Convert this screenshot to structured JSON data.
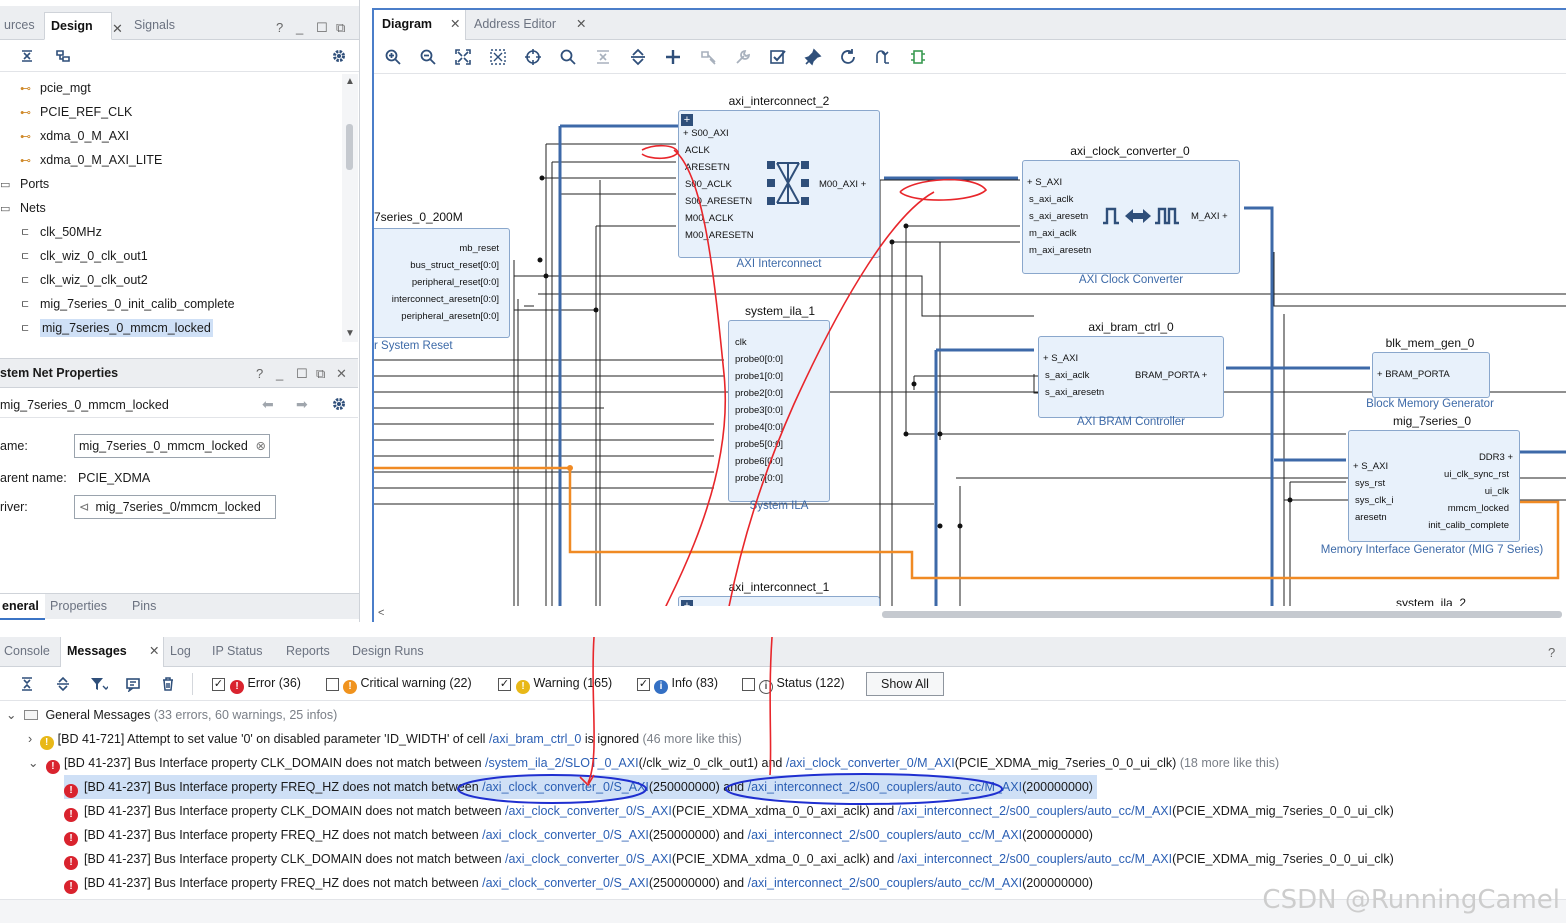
{
  "left": {
    "tabs": [
      "urces",
      "Design",
      "Signals"
    ],
    "tree": [
      {
        "label": "pcie_mgt",
        "kind": "port"
      },
      {
        "label": "PCIE_REF_CLK",
        "kind": "port"
      },
      {
        "label": "xdma_0_M_AXI",
        "kind": "port"
      },
      {
        "label": "xdma_0_M_AXI_LITE",
        "kind": "port"
      },
      {
        "label": "Ports",
        "kind": "folder"
      },
      {
        "label": "Nets",
        "kind": "folder"
      },
      {
        "label": "clk_50MHz",
        "kind": "net"
      },
      {
        "label": "clk_wiz_0_clk_out1",
        "kind": "net"
      },
      {
        "label": "clk_wiz_0_clk_out2",
        "kind": "net"
      },
      {
        "label": "mig_7series_0_init_calib_complete",
        "kind": "net"
      },
      {
        "label": "mig_7series_0_mmcm_locked",
        "kind": "net"
      }
    ],
    "props_title": "stem Net Properties",
    "props_net": "mig_7series_0_mmcm_locked",
    "name_label": "ame:",
    "name_value": "mig_7series_0_mmcm_locked",
    "parent_label": "arent name:",
    "parent_value": "PCIE_XDMA",
    "driver_label": "river:",
    "driver_value": "mig_7series_0/mmcm_locked",
    "bottom_tabs": [
      "eneral",
      "Properties",
      "Pins"
    ]
  },
  "diagram": {
    "tabs": [
      "Diagram",
      "Address Editor"
    ],
    "blocks": {
      "ic2": {
        "title": "axi_interconnect_2",
        "sub": "AXI Interconnect",
        "pins": [
          "S00_AXI",
          "ACLK",
          "ARESETN",
          "S00_ACLK",
          "S00_ARESETN",
          "M00_ACLK",
          "M00_ARESETN"
        ],
        "out": "M00_AXI"
      },
      "cc": {
        "title": "axi_clock_converter_0",
        "sub": "AXI Clock Converter",
        "pins": [
          "S_AXI",
          "s_axi_aclk",
          "s_axi_aresetn",
          "m_axi_aclk",
          "m_axi_aresetn"
        ],
        "out": "M_AXI"
      },
      "rst": {
        "title": "7series_0_200M",
        "sub": "r System Reset",
        "pins": [
          "mb_reset",
          "bus_struct_reset[0:0]",
          "peripheral_reset[0:0]",
          "interconnect_aresetn[0:0]",
          "peripheral_aresetn[0:0]"
        ]
      },
      "ila": {
        "title": "system_ila_1",
        "sub": "System ILA",
        "pins": [
          "clk",
          "probe0[0:0]",
          "probe1[0:0]",
          "probe2[0:0]",
          "probe3[0:0]",
          "probe4[0:0]",
          "probe5[0:0]",
          "probe6[0:0]",
          "probe7[0:0]"
        ]
      },
      "bram": {
        "title": "axi_bram_ctrl_0",
        "sub": "AXI BRAM Controller",
        "pins": [
          "S_AXI",
          "s_axi_aclk",
          "s_axi_aresetn"
        ],
        "out": "BRAM_PORTA"
      },
      "bmg": {
        "title": "blk_mem_gen_0",
        "sub": "Block Memory Generator",
        "pins": [
          "BRAM_PORTA"
        ]
      },
      "mig": {
        "title": "mig_7series_0",
        "sub": "Memory Interface Generator (MIG 7 Series)",
        "pins": [
          "S_AXI",
          "sys_rst",
          "sys_clk_i",
          "aresetn"
        ],
        "outs": [
          "DDR3",
          "ui_clk_sync_rst",
          "ui_clk",
          "mmcm_locked",
          "init_calib_complete"
        ]
      },
      "ic1": {
        "title": "axi_interconnect_1"
      },
      "ila2": {
        "title": "system_ila_2"
      }
    }
  },
  "messages": {
    "tabs": [
      "Console",
      "Messages",
      "Log",
      "IP Status",
      "Reports",
      "Design Runs"
    ],
    "filters": [
      {
        "label": "Error (36)",
        "checked": true,
        "color": "#d9232e",
        "glyph": "!"
      },
      {
        "label": "Critical warning (22)",
        "checked": false,
        "color": "#f0931e",
        "glyph": "!"
      },
      {
        "label": "Warning (165)",
        "checked": true,
        "color": "#e8b818",
        "glyph": "!"
      },
      {
        "label": "Info (83)",
        "checked": true,
        "color": "#3470c4",
        "glyph": "i"
      },
      {
        "label": "Status (122)",
        "checked": false,
        "color": "#ffffff",
        "glyph": "i"
      }
    ],
    "show_all": "Show All",
    "group": {
      "title": "General Messages",
      "counts": "(33 errors, 60 warnings, 25 infos)"
    },
    "rows": [
      {
        "type": "warning",
        "text1": "[BD 41-721] Attempt to set value '0' on disabled parameter 'ID_WIDTH' of cell ",
        "link1": "/axi_bram_ctrl_0",
        "text2": " is ignored ",
        "gray": "(46 more like this)"
      },
      {
        "type": "error",
        "text1": "[BD 41-237] Bus Interface property CLK_DOMAIN does not match between ",
        "link1": "/system_ila_2/SLOT_0_AXI",
        "text2": "(/clk_wiz_0_clk_out1) and ",
        "link2": "/axi_clock_converter_0/M_AXI",
        "text3": "(PCIE_XDMA_mig_7series_0_0_ui_clk) ",
        "gray": "(18 more like this)"
      },
      {
        "type": "error",
        "text1": "[BD 41-237] Bus Interface property FREQ_HZ does not match between ",
        "link1": "/axi_clock_converter_0/S_AXI",
        "text2": "(250000000) and ",
        "link2": "/axi_interconnect_2/s00_couplers/auto_cc/M_AXI",
        "text3": "(200000000)"
      },
      {
        "type": "error",
        "text1": "[BD 41-237] Bus Interface property CLK_DOMAIN does not match between ",
        "link1": "/axi_clock_converter_0/S_AXI",
        "text2": "(PCIE_XDMA_xdma_0_0_axi_aclk) and ",
        "link2": "/axi_interconnect_2/s00_couplers/auto_cc/M_AXI",
        "text3": "(PCIE_XDMA_mig_7series_0_0_ui_clk)"
      },
      {
        "type": "error",
        "text1": "[BD 41-237] Bus Interface property FREQ_HZ does not match between ",
        "link1": "/axi_clock_converter_0/S_AXI",
        "text2": "(250000000) and ",
        "link2": "/axi_interconnect_2/s00_couplers/auto_cc/M_AXI",
        "text3": "(200000000)"
      },
      {
        "type": "error",
        "text1": "[BD 41-237] Bus Interface property CLK_DOMAIN does not match between ",
        "link1": "/axi_clock_converter_0/S_AXI",
        "text2": "(PCIE_XDMA_xdma_0_0_axi_aclk) and ",
        "link2": "/axi_interconnect_2/s00_couplers/auto_cc/M_AXI",
        "text3": "(PCIE_XDMA_mig_7series_0_0_ui_clk)"
      },
      {
        "type": "error",
        "text1": "[BD 41-237] Bus Interface property FREQ_HZ does not match between ",
        "link1": "/axi_clock_converter_0/S_AXI",
        "text2": "(250000000) and ",
        "link2": "/axi_interconnect_2/s00_couplers/auto_cc/M_AXI",
        "text3": "(200000000)"
      }
    ]
  },
  "watermark": "CSDN @RunningCamel"
}
